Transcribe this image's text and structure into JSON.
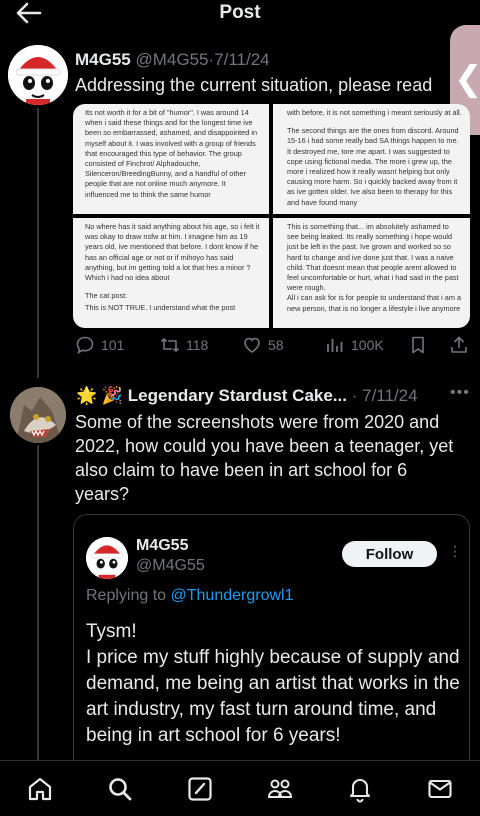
{
  "header": {
    "title": "Post"
  },
  "tweet1": {
    "display_name": "M4G55",
    "handle": "@M4G55",
    "separator": "·",
    "date": "7/11/24",
    "text": "Addressing the current situation, please read",
    "screenshots": [
      {
        "paragraphs": [
          "Its not worth it for a bit of \"humor\". I was around 14 when i said these things and for the longest time ive been so embarrassed, ashamed, and disappointed in myself about it. I was involved with a group of friends that encouraged this type of behavior. The group consisted of Finchrot/ Alphadouche, Silenceron/BreedingBunny, and a handful of other people that are not online much anymore. It influenced me to think the same humor"
        ]
      },
      {
        "paragraphs": [
          "with before, it is not something i meant seriously at all.",
          "The second things are the ones from discord. Around 15-16 i had some really bad SA things happen to me. It destroyed me, tore me apart. I was suggested to cope using fictional media. The more i grew up, the more i realized how it really wasnt helping but only causing more harm. So i quickly backed away from it as ive gotten older. Ive also been to therapy for this and have found many"
        ]
      },
      {
        "paragraphs": [
          "No where has it said anything about his age, so i felt it was okay to draw nsfw at him. I imagine him as 19 years old, ive mentioned that before. I dont know if he has an official age or not or if mihoyo has said anything, but im getting told a lot that hes a minor ? Which i had no idea about",
          "The cat post:",
          "This is NOT TRUE. I understand what the post"
        ]
      },
      {
        "paragraphs": [
          "This is something that... im absolutely ashamed to see being leaked. Its really something i hope would just be left in the past. Ive grown and worked so so hard to change and ive done just that. I was a naive child. That doesnt mean that people arent allowed to feel uncomfortable or hurt, what i had said in the past were rough.",
          "All i can ask for is for people to understand that i am a new person, that is no longer a lifestyle i live anymore"
        ]
      }
    ],
    "stats": {
      "replies": "101",
      "reposts": "118",
      "likes": "58",
      "views": "100K"
    }
  },
  "tweet2": {
    "display_name": "Legendary Stardust Cake...",
    "separator": "·",
    "date": "7/11/24",
    "text": "Some of the screenshots were from 2020 and 2022, how could you have been a teenager, yet also claim to have been in art school for 6 years?",
    "name_emojis": "🌟 🎉"
  },
  "quote": {
    "display_name": "M4G55",
    "handle": "@M4G55",
    "follow_label": "Follow",
    "reply_prefix": "Replying to ",
    "reply_mention": "@Thundergrowl1",
    "text": "Tysm!\nI price my stuff highly because of supply and demand, me being an artist that works in the art industry, my fast turn around time, and being in art school for 6 years!"
  },
  "colors": {
    "background": "#000000",
    "text": "#e7e9ea",
    "muted": "#71767b",
    "link": "#1d9bf0",
    "avatar_hat": "#d62828"
  },
  "nav_icons": [
    "home-icon",
    "search-icon",
    "compose-icon",
    "communities-icon",
    "notifications-icon",
    "messages-icon"
  ]
}
